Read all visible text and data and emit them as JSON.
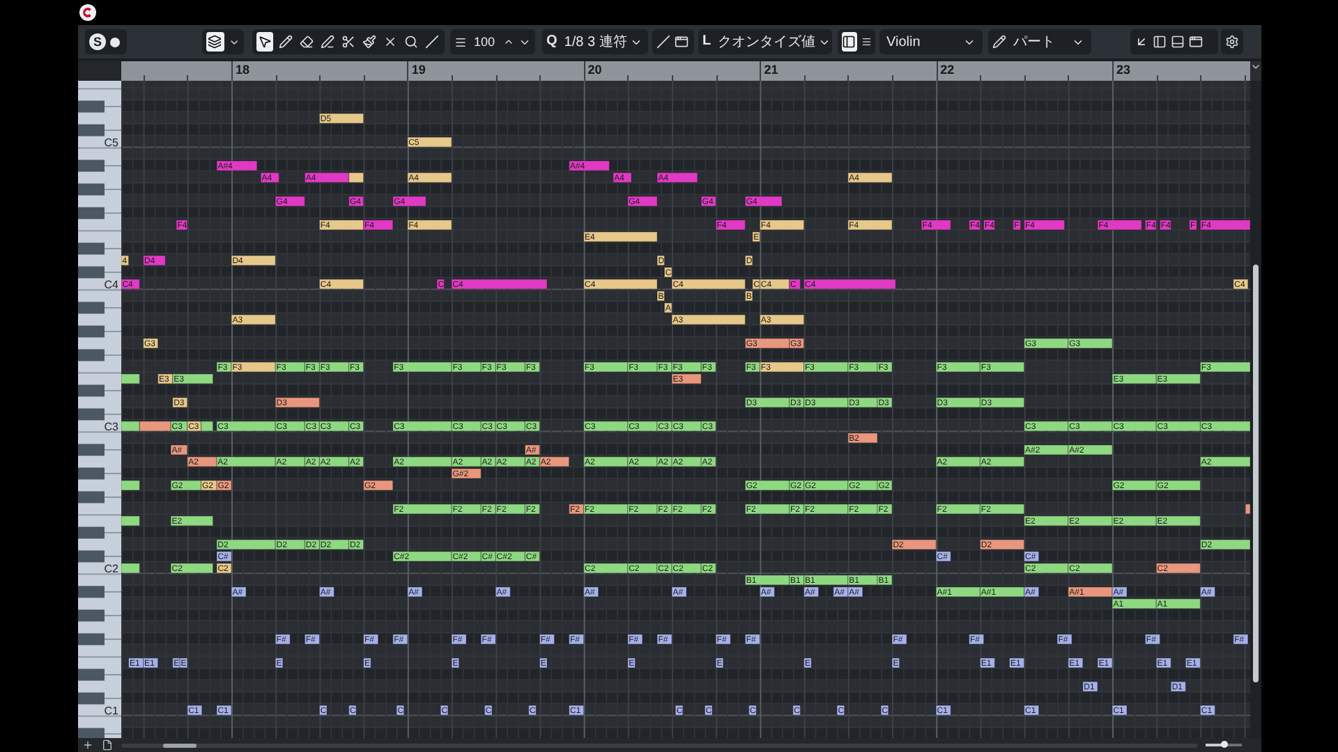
{
  "toolbar": {
    "solo": "S",
    "tools": [
      {
        "kind": "select",
        "selected": true
      },
      {
        "kind": "draw",
        "selected": false
      },
      {
        "kind": "erase",
        "selected": false
      },
      {
        "kind": "trim",
        "selected": false
      },
      {
        "kind": "split",
        "selected": false
      },
      {
        "kind": "glue",
        "selected": false
      },
      {
        "kind": "mute",
        "selected": false
      },
      {
        "kind": "zoom",
        "selected": false
      },
      {
        "kind": "line",
        "selected": false
      }
    ],
    "velocity": "100",
    "quantize_letter": "Q",
    "quantize": "1/8 3 連符",
    "length_letter": "L",
    "length_quantize": "クオンタイズ値",
    "track": "Violin",
    "part": "パート"
  },
  "ruler": {
    "bars": [
      "18",
      "19",
      "20",
      "21",
      "22",
      "23"
    ]
  },
  "keyboard": {
    "octave_labels": [
      "C5",
      "C4",
      "C3",
      "C2",
      "C1"
    ]
  },
  "notes": [
    {
      "label": "D5",
      "color": "#e6c88a"
    },
    {
      "label": "C5",
      "color": "#e6c88a"
    },
    {
      "label": "A#4",
      "color": "#e03ac4"
    },
    {
      "label": "A#4",
      "color": "#e03ac4"
    },
    {
      "label": "A4",
      "color": "#e03ac4"
    },
    {
      "label": "A4",
      "color": "#e03ac4"
    },
    {
      "color": "#e6c88a"
    },
    {
      "label": "A4",
      "color": "#e6c88a"
    },
    {
      "label": "A4",
      "color": "#e03ac4"
    },
    {
      "label": "A4",
      "color": "#e03ac4"
    },
    {
      "label": "A4",
      "color": "#e6c88a"
    },
    {
      "label": "G4",
      "color": "#e03ac4"
    },
    {
      "label": "G4",
      "color": "#e03ac4"
    },
    {
      "label": "G4",
      "color": "#e03ac4"
    },
    {
      "label": "G4",
      "color": "#e03ac4"
    },
    {
      "label": "G4",
      "color": "#e03ac4"
    },
    {
      "label": "G4",
      "color": "#e03ac4"
    },
    {
      "label": "F4",
      "color": "#e03ac4"
    },
    {
      "label": "F4",
      "color": "#e6c88a"
    },
    {
      "label": "F4",
      "color": "#e03ac4"
    },
    {
      "label": "F4",
      "color": "#e6c88a"
    },
    {
      "label": "F4",
      "color": "#e03ac4"
    },
    {
      "label": "F4",
      "color": "#e6c88a"
    },
    {
      "label": "F4",
      "color": "#e6c88a"
    },
    {
      "label": "F4",
      "color": "#e03ac4"
    },
    {
      "label": "F4",
      "color": "#e03ac4"
    },
    {
      "label": "F4",
      "color": "#e03ac4"
    },
    {
      "label": "F",
      "color": "#e03ac4"
    },
    {
      "label": "F4",
      "color": "#e03ac4"
    },
    {
      "label": "F4",
      "color": "#e03ac4"
    },
    {
      "label": "F4",
      "color": "#e03ac4"
    },
    {
      "label": "F4",
      "color": "#e03ac4"
    },
    {
      "label": "F",
      "color": "#e03ac4"
    },
    {
      "label": "F4",
      "color": "#e03ac4"
    },
    {
      "label": "E4",
      "color": "#e6c88a"
    },
    {
      "label": "E",
      "color": "#e6c88a"
    },
    {
      "label": "4",
      "color": "#e6c88a"
    },
    {
      "label": "D4",
      "color": "#e03ac4"
    },
    {
      "label": "D4",
      "color": "#e6c88a"
    },
    {
      "label": "D",
      "color": "#e6c88a"
    },
    {
      "label": "D",
      "color": "#e6c88a"
    },
    {
      "label": "C",
      "color": "#e6c88a"
    },
    {
      "label": "C4",
      "color": "#e03ac4"
    },
    {
      "label": "C4",
      "color": "#e6c88a"
    },
    {
      "label": "C",
      "color": "#e03ac4"
    },
    {
      "label": "C4",
      "color": "#e03ac4"
    },
    {
      "label": "C4",
      "color": "#e6c88a"
    },
    {
      "label": "C4",
      "color": "#e6c88a"
    },
    {
      "label": "C",
      "color": "#e6c88a"
    },
    {
      "label": "C4",
      "color": "#e6c88a"
    },
    {
      "label": "C",
      "color": "#e03ac4"
    },
    {
      "label": "C4",
      "color": "#e03ac4"
    },
    {
      "label": "C4",
      "color": "#e6c88a"
    },
    {
      "label": "B",
      "color": "#e6c88a"
    },
    {
      "label": "B",
      "color": "#e6c88a"
    },
    {
      "label": "A",
      "color": "#e6c88a"
    },
    {
      "label": "A3",
      "color": "#e6c88a"
    },
    {
      "label": "A3",
      "color": "#e6c88a"
    },
    {
      "label": "A3",
      "color": "#e6c88a"
    },
    {
      "label": "G3",
      "color": "#e6c88a"
    },
    {
      "label": "G3",
      "color": "#e8977e"
    },
    {
      "label": "G3",
      "color": "#e8977e"
    },
    {
      "label": "G3",
      "color": "#8fd882"
    },
    {
      "label": "G3",
      "color": "#8fd882"
    },
    {
      "label": "F3",
      "color": "#8fd882"
    },
    {
      "label": "F3",
      "color": "#e6c88a"
    },
    {
      "label": "F3",
      "color": "#8fd882"
    },
    {
      "label": "F3",
      "color": "#8fd882"
    },
    {
      "label": "F3",
      "color": "#8fd882"
    },
    {
      "label": "F3",
      "color": "#8fd882"
    },
    {
      "label": "F3",
      "color": "#8fd882"
    },
    {
      "label": "F3",
      "color": "#8fd882"
    },
    {
      "label": "F3",
      "color": "#8fd882"
    },
    {
      "label": "F3",
      "color": "#8fd882"
    },
    {
      "label": "F3",
      "color": "#8fd882"
    },
    {
      "label": "F3",
      "color": "#8fd882"
    },
    {
      "label": "F3",
      "color": "#8fd882"
    },
    {
      "label": "F3",
      "color": "#8fd882"
    },
    {
      "label": "F3",
      "color": "#8fd882"
    },
    {
      "label": "F3",
      "color": "#8fd882"
    },
    {
      "label": "F3",
      "color": "#8fd882"
    },
    {
      "label": "F3",
      "color": "#e6c88a"
    },
    {
      "label": "F3",
      "color": "#8fd882"
    },
    {
      "label": "F3",
      "color": "#8fd882"
    },
    {
      "label": "F3",
      "color": "#8fd882"
    },
    {
      "label": "F3",
      "color": "#8fd882"
    },
    {
      "label": "F3",
      "color": "#8fd882"
    },
    {
      "label": "F3",
      "color": "#8fd882"
    },
    {
      "color": "#8fd882"
    },
    {
      "label": "E3",
      "color": "#e6c88a"
    },
    {
      "label": "E3",
      "color": "#8fd882"
    },
    {
      "label": "E3",
      "color": "#e8977e"
    },
    {
      "label": "E3",
      "color": "#8fd882"
    },
    {
      "label": "E3",
      "color": "#8fd882"
    },
    {
      "label": "D3",
      "color": "#e6c88a"
    },
    {
      "label": "D3",
      "color": "#e8977e"
    },
    {
      "label": "D3",
      "color": "#8fd882"
    },
    {
      "label": "D3",
      "color": "#8fd882"
    },
    {
      "label": "D3",
      "color": "#8fd882"
    },
    {
      "label": "D3",
      "color": "#8fd882"
    },
    {
      "label": "D3",
      "color": "#8fd882"
    },
    {
      "label": "D3",
      "color": "#8fd882"
    },
    {
      "label": "D3",
      "color": "#8fd882"
    },
    {
      "color": "#8fd882"
    },
    {
      "color": "#e8977e"
    },
    {
      "label": "C3",
      "color": "#8fd882"
    },
    {
      "label": "C3",
      "color": "#e6c88a"
    },
    {
      "color": "#8fd882"
    },
    {
      "label": "C3",
      "color": "#8fd882"
    },
    {
      "label": "C3",
      "color": "#8fd882"
    },
    {
      "label": "C3",
      "color": "#8fd882"
    },
    {
      "label": "C3",
      "color": "#8fd882"
    },
    {
      "label": "C3",
      "color": "#8fd882"
    },
    {
      "label": "C3",
      "color": "#8fd882"
    },
    {
      "label": "C3",
      "color": "#8fd882"
    },
    {
      "label": "C3",
      "color": "#8fd882"
    },
    {
      "label": "C3",
      "color": "#8fd882"
    },
    {
      "label": "C3",
      "color": "#8fd882"
    },
    {
      "label": "C3",
      "color": "#8fd882"
    },
    {
      "label": "C3",
      "color": "#8fd882"
    },
    {
      "label": "C3",
      "color": "#8fd882"
    },
    {
      "label": "C3",
      "color": "#8fd882"
    },
    {
      "label": "C3",
      "color": "#8fd882"
    },
    {
      "label": "C3",
      "color": "#8fd882"
    },
    {
      "label": "C3",
      "color": "#8fd882"
    },
    {
      "label": "C3",
      "color": "#8fd882"
    },
    {
      "label": "C3",
      "color": "#8fd882"
    },
    {
      "label": "C3",
      "color": "#8fd882"
    },
    {
      "label": "B2",
      "color": "#e8977e"
    },
    {
      "label": "A#",
      "color": "#e8977e"
    },
    {
      "label": "A#",
      "color": "#e8977e"
    },
    {
      "label": "A#2",
      "color": "#8fd882"
    },
    {
      "label": "A#2",
      "color": "#8fd882"
    },
    {
      "label": "A2",
      "color": "#e8977e"
    },
    {
      "label": "A2",
      "color": "#8fd882"
    },
    {
      "label": "A2",
      "color": "#8fd882"
    },
    {
      "label": "A2",
      "color": "#8fd882"
    },
    {
      "label": "A2",
      "color": "#8fd882"
    },
    {
      "label": "A2",
      "color": "#8fd882"
    },
    {
      "label": "A2",
      "color": "#8fd882"
    },
    {
      "label": "A2",
      "color": "#8fd882"
    },
    {
      "label": "A2",
      "color": "#8fd882"
    },
    {
      "label": "A2",
      "color": "#8fd882"
    },
    {
      "label": "A2",
      "color": "#8fd882"
    },
    {
      "label": "A2",
      "color": "#e8977e"
    },
    {
      "label": "A2",
      "color": "#8fd882"
    },
    {
      "label": "A2",
      "color": "#8fd882"
    },
    {
      "label": "A2",
      "color": "#8fd882"
    },
    {
      "label": "A2",
      "color": "#8fd882"
    },
    {
      "label": "A2",
      "color": "#8fd882"
    },
    {
      "label": "A2",
      "color": "#8fd882"
    },
    {
      "label": "A2",
      "color": "#8fd882"
    },
    {
      "label": "A2",
      "color": "#8fd882"
    },
    {
      "label": "G#2",
      "color": "#e8977e"
    },
    {
      "color": "#8fd882"
    },
    {
      "label": "G2",
      "color": "#8fd882"
    },
    {
      "label": "G2",
      "color": "#e6c88a"
    },
    {
      "label": "G2",
      "color": "#e8977e"
    },
    {
      "label": "G2",
      "color": "#e8977e"
    },
    {
      "label": "G2",
      "color": "#8fd882"
    },
    {
      "label": "G2",
      "color": "#8fd882"
    },
    {
      "label": "G2",
      "color": "#8fd882"
    },
    {
      "label": "G2",
      "color": "#8fd882"
    },
    {
      "label": "G2",
      "color": "#8fd882"
    },
    {
      "label": "G2",
      "color": "#8fd882"
    },
    {
      "label": "G2",
      "color": "#8fd882"
    },
    {
      "label": "F2",
      "color": "#8fd882"
    },
    {
      "label": "F2",
      "color": "#8fd882"
    },
    {
      "label": "F2",
      "color": "#8fd882"
    },
    {
      "label": "F2",
      "color": "#8fd882"
    },
    {
      "label": "F2",
      "color": "#8fd882"
    },
    {
      "label": "F2",
      "color": "#e8977e"
    },
    {
      "label": "F2",
      "color": "#8fd882"
    },
    {
      "label": "F2",
      "color": "#8fd882"
    },
    {
      "label": "F2",
      "color": "#8fd882"
    },
    {
      "label": "F2",
      "color": "#8fd882"
    },
    {
      "label": "F2",
      "color": "#8fd882"
    },
    {
      "label": "F2",
      "color": "#8fd882"
    },
    {
      "label": "F2",
      "color": "#8fd882"
    },
    {
      "label": "F2",
      "color": "#8fd882"
    },
    {
      "label": "F2",
      "color": "#8fd882"
    },
    {
      "label": "F2",
      "color": "#8fd882"
    },
    {
      "label": "F2",
      "color": "#8fd882"
    },
    {
      "label": "F2",
      "color": "#8fd882"
    },
    {
      "color": "#e8977e"
    },
    {
      "color": "#8fd882"
    },
    {
      "label": "E2",
      "color": "#8fd882"
    },
    {
      "label": "E2",
      "color": "#8fd882"
    },
    {
      "label": "E2",
      "color": "#8fd882"
    },
    {
      "label": "E2",
      "color": "#8fd882"
    },
    {
      "label": "E2",
      "color": "#8fd882"
    },
    {
      "label": "D2",
      "color": "#8fd882"
    },
    {
      "label": "D2",
      "color": "#8fd882"
    },
    {
      "label": "D2",
      "color": "#8fd882"
    },
    {
      "label": "D2",
      "color": "#8fd882"
    },
    {
      "label": "D2",
      "color": "#8fd882"
    },
    {
      "label": "D2",
      "color": "#e8977e"
    },
    {
      "label": "D2",
      "color": "#e8977e"
    },
    {
      "label": "D2",
      "color": "#8fd882"
    },
    {
      "label": "C#",
      "color": "#a6b1ea"
    },
    {
      "label": "C#2",
      "color": "#8fd882"
    },
    {
      "label": "C#2",
      "color": "#8fd882"
    },
    {
      "label": "C#",
      "color": "#8fd882"
    },
    {
      "label": "C#2",
      "color": "#8fd882"
    },
    {
      "label": "C#",
      "color": "#8fd882"
    },
    {
      "label": "C#",
      "color": "#a6b1ea"
    },
    {
      "label": "C#",
      "color": "#a6b1ea"
    },
    {
      "color": "#8fd882"
    },
    {
      "label": "C2",
      "color": "#8fd882"
    },
    {
      "label": "C2",
      "color": "#e6c88a"
    },
    {
      "label": "C2",
      "color": "#8fd882"
    },
    {
      "label": "C2",
      "color": "#8fd882"
    },
    {
      "label": "C2",
      "color": "#8fd882"
    },
    {
      "label": "C2",
      "color": "#8fd882"
    },
    {
      "label": "C2",
      "color": "#8fd882"
    },
    {
      "label": "C2",
      "color": "#8fd882"
    },
    {
      "label": "C2",
      "color": "#8fd882"
    },
    {
      "label": "C2",
      "color": "#e8977e"
    },
    {
      "label": "B1",
      "color": "#8fd882"
    },
    {
      "label": "B1",
      "color": "#8fd882"
    },
    {
      "label": "B1",
      "color": "#8fd882"
    },
    {
      "label": "B1",
      "color": "#8fd882"
    },
    {
      "label": "B1",
      "color": "#8fd882"
    },
    {
      "label": "A#",
      "color": "#a6b1ea"
    },
    {
      "label": "A#",
      "color": "#a6b1ea"
    },
    {
      "label": "A#",
      "color": "#a6b1ea"
    },
    {
      "label": "A#",
      "color": "#a6b1ea"
    },
    {
      "label": "A#",
      "color": "#a6b1ea"
    },
    {
      "label": "A#",
      "color": "#a6b1ea"
    },
    {
      "label": "A#",
      "color": "#a6b1ea"
    },
    {
      "label": "A#",
      "color": "#a6b1ea"
    },
    {
      "label": "A#",
      "color": "#a6b1ea"
    },
    {
      "label": "A#",
      "color": "#a6b1ea"
    },
    {
      "label": "A#1",
      "color": "#8fd882"
    },
    {
      "label": "A#1",
      "color": "#8fd882"
    },
    {
      "label": "A#",
      "color": "#a6b1ea"
    },
    {
      "label": "A#1",
      "color": "#e8977e"
    },
    {
      "label": "A#",
      "color": "#a6b1ea"
    },
    {
      "label": "A#",
      "color": "#a6b1ea"
    },
    {
      "label": "A1",
      "color": "#8fd882"
    },
    {
      "label": "A1",
      "color": "#8fd882"
    },
    {
      "label": "F#",
      "color": "#a6b1ea"
    },
    {
      "label": "F#",
      "color": "#a6b1ea"
    },
    {
      "label": "F#",
      "color": "#a6b1ea"
    },
    {
      "label": "F#",
      "color": "#a6b1ea"
    },
    {
      "label": "F#",
      "color": "#a6b1ea"
    },
    {
      "label": "F#",
      "color": "#a6b1ea"
    },
    {
      "label": "F#",
      "color": "#a6b1ea"
    },
    {
      "label": "F#",
      "color": "#a6b1ea"
    },
    {
      "label": "F#",
      "color": "#a6b1ea"
    },
    {
      "label": "F#",
      "color": "#a6b1ea"
    },
    {
      "label": "F#",
      "color": "#a6b1ea"
    },
    {
      "label": "F#",
      "color": "#a6b1ea"
    },
    {
      "label": "F#",
      "color": "#a6b1ea"
    },
    {
      "label": "F#",
      "color": "#a6b1ea"
    },
    {
      "label": "F#",
      "color": "#a6b1ea"
    },
    {
      "label": "F#",
      "color": "#a6b1ea"
    },
    {
      "label": "F#",
      "color": "#a6b1ea"
    },
    {
      "label": "E1",
      "color": "#a6b1ea"
    },
    {
      "label": "E1",
      "color": "#a6b1ea"
    },
    {
      "label": "E",
      "color": "#a6b1ea"
    },
    {
      "label": "E",
      "color": "#a6b1ea"
    },
    {
      "label": "E",
      "color": "#a6b1ea"
    },
    {
      "label": "E",
      "color": "#a6b1ea"
    },
    {
      "label": "E",
      "color": "#a6b1ea"
    },
    {
      "label": "E",
      "color": "#a6b1ea"
    },
    {
      "label": "E",
      "color": "#a6b1ea"
    },
    {
      "label": "E",
      "color": "#a6b1ea"
    },
    {
      "label": "E",
      "color": "#a6b1ea"
    },
    {
      "label": "E",
      "color": "#a6b1ea"
    },
    {
      "label": "E1",
      "color": "#a6b1ea"
    },
    {
      "label": "E1",
      "color": "#a6b1ea"
    },
    {
      "label": "E1",
      "color": "#a6b1ea"
    },
    {
      "label": "E1",
      "color": "#a6b1ea"
    },
    {
      "label": "E1",
      "color": "#a6b1ea"
    },
    {
      "label": "E1",
      "color": "#a6b1ea"
    },
    {
      "label": "D1",
      "color": "#a6b1ea"
    },
    {
      "label": "D1",
      "color": "#a6b1ea"
    },
    {
      "label": "C1",
      "color": "#a6b1ea"
    },
    {
      "label": "C1",
      "color": "#a6b1ea"
    },
    {
      "label": "C",
      "color": "#a6b1ea"
    },
    {
      "label": "C",
      "color": "#a6b1ea"
    },
    {
      "label": "C",
      "color": "#a6b1ea"
    },
    {
      "label": "C",
      "color": "#a6b1ea"
    },
    {
      "label": "C",
      "color": "#a6b1ea"
    },
    {
      "label": "C",
      "color": "#a6b1ea"
    },
    {
      "label": "C1",
      "color": "#a6b1ea"
    },
    {
      "label": "C",
      "color": "#a6b1ea"
    },
    {
      "label": "C",
      "color": "#a6b1ea"
    },
    {
      "label": "C",
      "color": "#a6b1ea"
    },
    {
      "label": "C",
      "color": "#a6b1ea"
    },
    {
      "label": "C",
      "color": "#a6b1ea"
    },
    {
      "label": "C",
      "color": "#a6b1ea"
    },
    {
      "label": "C1",
      "color": "#a6b1ea"
    },
    {
      "label": "C1",
      "color": "#a6b1ea"
    },
    {
      "label": "C1",
      "color": "#a6b1ea"
    },
    {
      "label": "C1",
      "color": "#a6b1ea"
    }
  ],
  "zoom_slider": {
    "level": 0.5
  }
}
